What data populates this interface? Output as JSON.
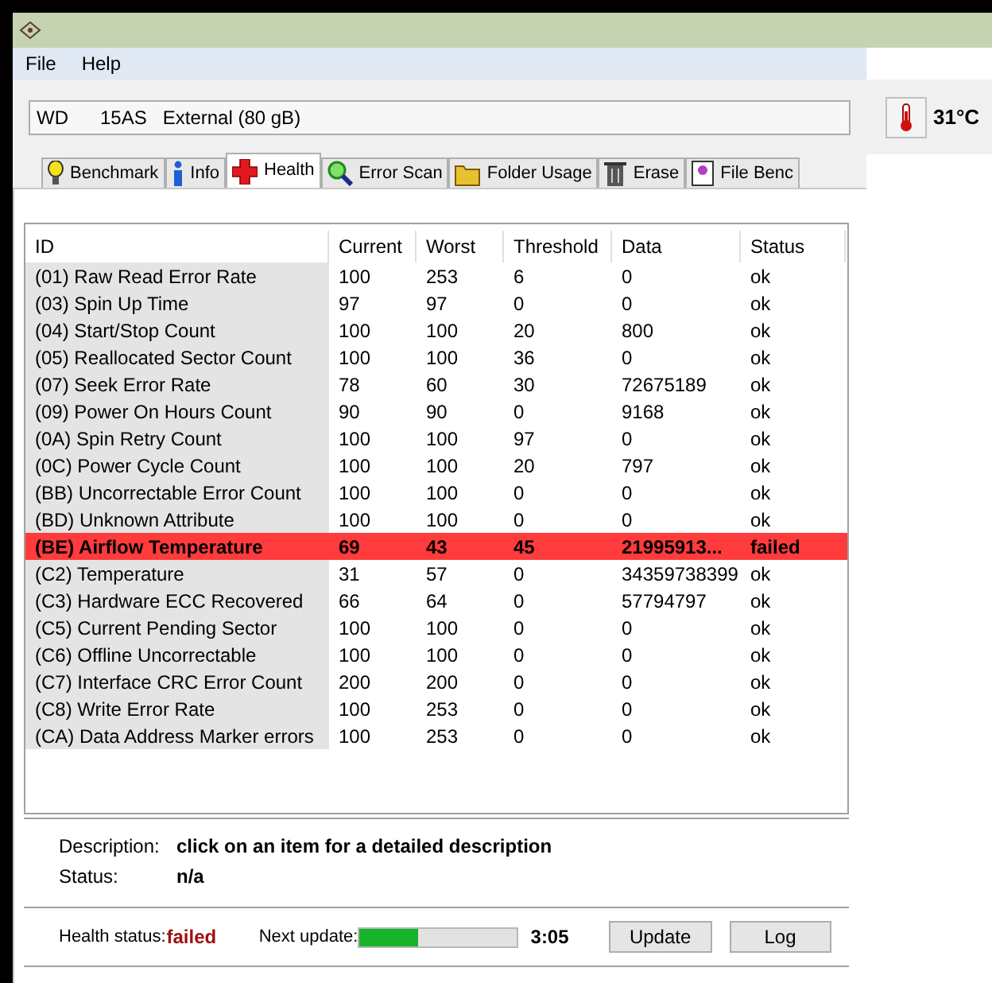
{
  "menu": [
    {
      "label": "File"
    },
    {
      "label": "Help"
    }
  ],
  "drive": {
    "value": "WD      15AS   External (80 gB)"
  },
  "temperature": "31°C",
  "tabs": [
    {
      "label": "Benchmark",
      "kind": "bulb",
      "selected": false
    },
    {
      "label": "Info",
      "kind": "info",
      "selected": false
    },
    {
      "label": "Health",
      "kind": "cross",
      "selected": true
    },
    {
      "label": "Error Scan",
      "kind": "magnifier",
      "selected": false
    },
    {
      "label": "Folder Usage",
      "kind": "folder",
      "selected": false
    },
    {
      "label": "Erase",
      "kind": "trash",
      "selected": false
    },
    {
      "label": "File Benc",
      "kind": "file",
      "selected": false
    }
  ],
  "table": {
    "columns": [
      "ID",
      "Current",
      "Worst",
      "Threshold",
      "Data",
      "Status"
    ],
    "rows": [
      {
        "cells": [
          "(01) Raw Read Error Rate",
          "100",
          "253",
          "6",
          "0",
          "ok"
        ],
        "failed": false
      },
      {
        "cells": [
          "(03) Spin Up Time",
          "97",
          "97",
          "0",
          "0",
          "ok"
        ],
        "failed": false
      },
      {
        "cells": [
          "(04) Start/Stop Count",
          "100",
          "100",
          "20",
          "800",
          "ok"
        ],
        "failed": false
      },
      {
        "cells": [
          "(05) Reallocated Sector Count",
          "100",
          "100",
          "36",
          "0",
          "ok"
        ],
        "failed": false
      },
      {
        "cells": [
          "(07) Seek Error Rate",
          "78",
          "60",
          "30",
          "72675189",
          "ok"
        ],
        "failed": false
      },
      {
        "cells": [
          "(09) Power On Hours Count",
          "90",
          "90",
          "0",
          "9168",
          "ok"
        ],
        "failed": false
      },
      {
        "cells": [
          "(0A) Spin Retry Count",
          "100",
          "100",
          "97",
          "0",
          "ok"
        ],
        "failed": false
      },
      {
        "cells": [
          "(0C) Power Cycle Count",
          "100",
          "100",
          "20",
          "797",
          "ok"
        ],
        "failed": false
      },
      {
        "cells": [
          "(BB) Uncorrectable Error Count",
          "100",
          "100",
          "0",
          "0",
          "ok"
        ],
        "failed": false
      },
      {
        "cells": [
          "(BD) Unknown Attribute",
          "100",
          "100",
          "0",
          "0",
          "ok"
        ],
        "failed": false
      },
      {
        "cells": [
          "(BE) Airflow Temperature",
          "69",
          "43",
          "45",
          "21995913...",
          "failed"
        ],
        "failed": true
      },
      {
        "cells": [
          "(C2) Temperature",
          "31",
          "57",
          "0",
          "34359738399",
          "ok"
        ],
        "failed": false
      },
      {
        "cells": [
          "(C3) Hardware ECC Recovered",
          "66",
          "64",
          "0",
          "57794797",
          "ok"
        ],
        "failed": false
      },
      {
        "cells": [
          "(C5) Current Pending Sector",
          "100",
          "100",
          "0",
          "0",
          "ok"
        ],
        "failed": false
      },
      {
        "cells": [
          "(C6) Offline Uncorrectable",
          "100",
          "100",
          "0",
          "0",
          "ok"
        ],
        "failed": false
      },
      {
        "cells": [
          "(C7) Interface CRC Error Count",
          "200",
          "200",
          "0",
          "0",
          "ok"
        ],
        "failed": false
      },
      {
        "cells": [
          "(C8) Write Error Rate",
          "100",
          "253",
          "0",
          "0",
          "ok"
        ],
        "failed": false
      },
      {
        "cells": [
          "(CA) Data Address Marker errors",
          "100",
          "253",
          "0",
          "0",
          "ok"
        ],
        "failed": false
      }
    ]
  },
  "description": {
    "label": "Description:",
    "value": "click on an item for a detailed description"
  },
  "status": {
    "label": "Status:",
    "value": "n/a"
  },
  "health": {
    "label": "Health status:",
    "value": "failed"
  },
  "next_update": {
    "label": "Next update:",
    "level": 0.37,
    "time": "3:05"
  },
  "buttons": [
    "Update",
    "Log"
  ]
}
